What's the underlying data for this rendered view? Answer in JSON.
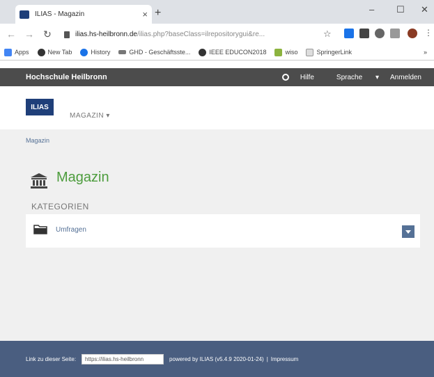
{
  "browser": {
    "tab_title": "ILIAS - Magazin",
    "url_host": "ilias.hs-heilbronn.de",
    "url_rest": "/ilias.php?baseClass=ilrepositorygui&re...",
    "bookmarks": [
      "Apps",
      "New Tab",
      "History",
      "GHD - Geschäftsste...",
      "IEEE EDUCON2018",
      "wiso",
      "SpringerLink"
    ]
  },
  "topbar": {
    "brand": "Hochschule Heilbronn",
    "help": "Hilfe",
    "language": "Sprache",
    "login": "Anmelden"
  },
  "header": {
    "logo": "ILIAS",
    "menu": "MAGAZIN"
  },
  "main": {
    "breadcrumb": "Magazin",
    "title": "Magazin",
    "section": "KATEGORIEN",
    "items": [
      {
        "label": "Umfragen"
      }
    ]
  },
  "footer": {
    "link_label": "Link zu dieser Seite:",
    "permalink": "https://ilias.hs-heilbronn",
    "powered": "powered by ILIAS (v5.4.9 2020-01-24)",
    "separator": "|",
    "impressum": "Impressum"
  },
  "colors": {
    "topbar": "#4c4c4c",
    "logo": "#1f3f79",
    "title": "#4c9c3c",
    "link": "#557196",
    "footer": "#4a5e80"
  }
}
